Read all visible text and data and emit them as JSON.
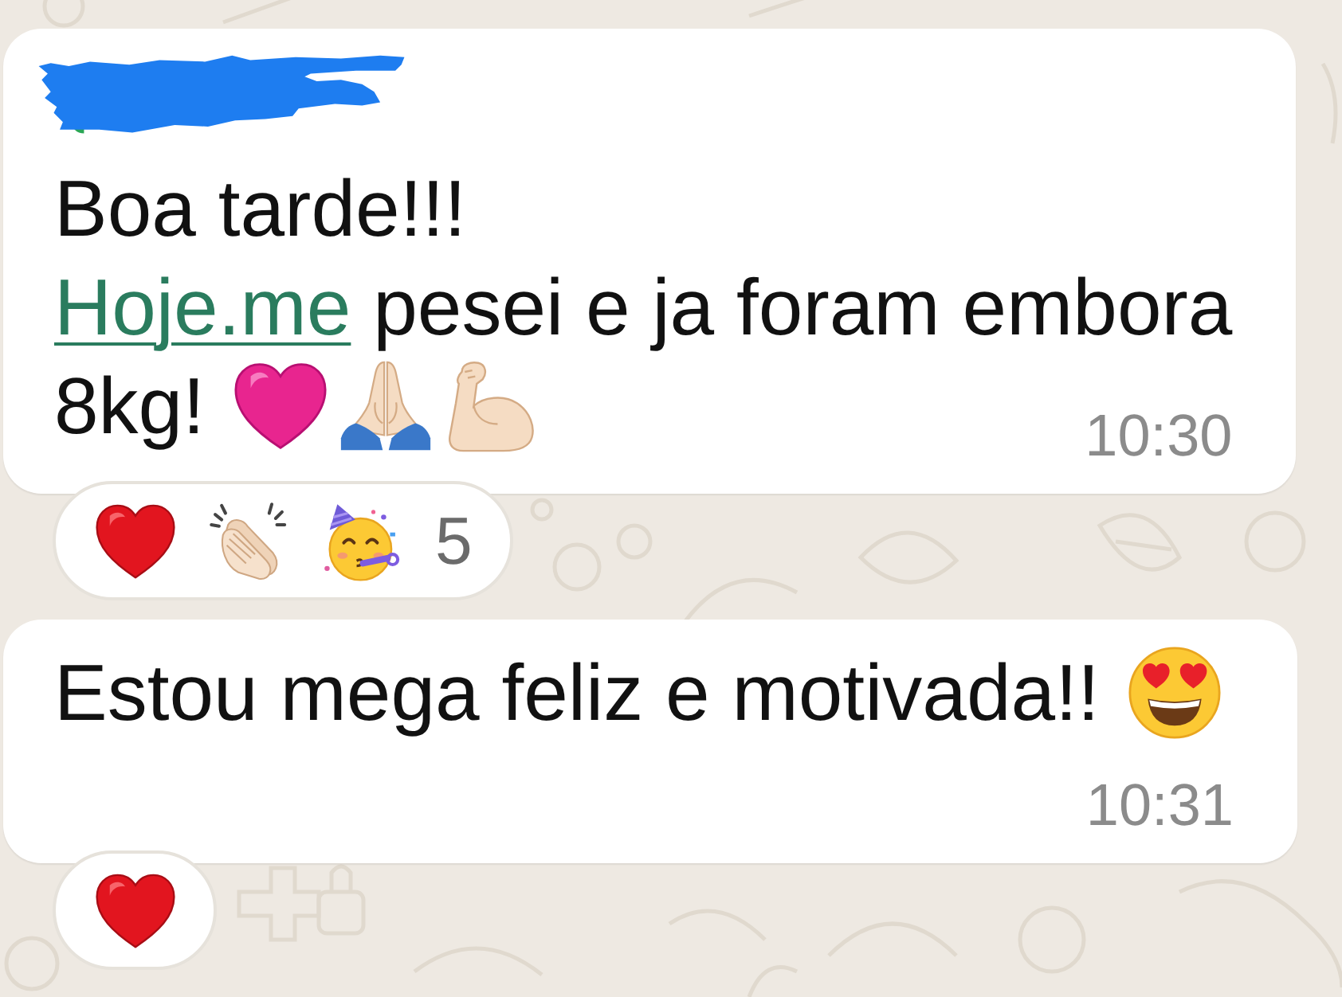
{
  "chat": {
    "messages": [
      {
        "sender_redacted": true,
        "lines": [
          {
            "segments": [
              {
                "kind": "text",
                "text": "Boa tarde!!!"
              }
            ]
          },
          {
            "segments": [
              {
                "kind": "link",
                "text": "Hoje.me"
              },
              {
                "kind": "text",
                "text": " pesei e ja foram embora"
              }
            ]
          },
          {
            "segments": [
              {
                "kind": "text",
                "text": "8kg!"
              },
              {
                "kind": "pink_heart"
              },
              {
                "kind": "praying_hands"
              },
              {
                "kind": "flexed_biceps"
              }
            ]
          }
        ],
        "time": "10:30",
        "reactions": {
          "emojis": [
            {
              "kind": "red_heart"
            },
            {
              "kind": "clapping_hands"
            },
            {
              "kind": "party_face"
            }
          ],
          "count": "5"
        }
      },
      {
        "sender_redacted": false,
        "lines": [
          {
            "segments": [
              {
                "kind": "text",
                "text": "Estou mega feliz e motivada!!"
              },
              {
                "kind": "heart_eyes"
              }
            ]
          }
        ],
        "time": "10:31",
        "reactions": {
          "emojis": [
            {
              "kind": "red_heart"
            }
          ]
        }
      }
    ]
  }
}
